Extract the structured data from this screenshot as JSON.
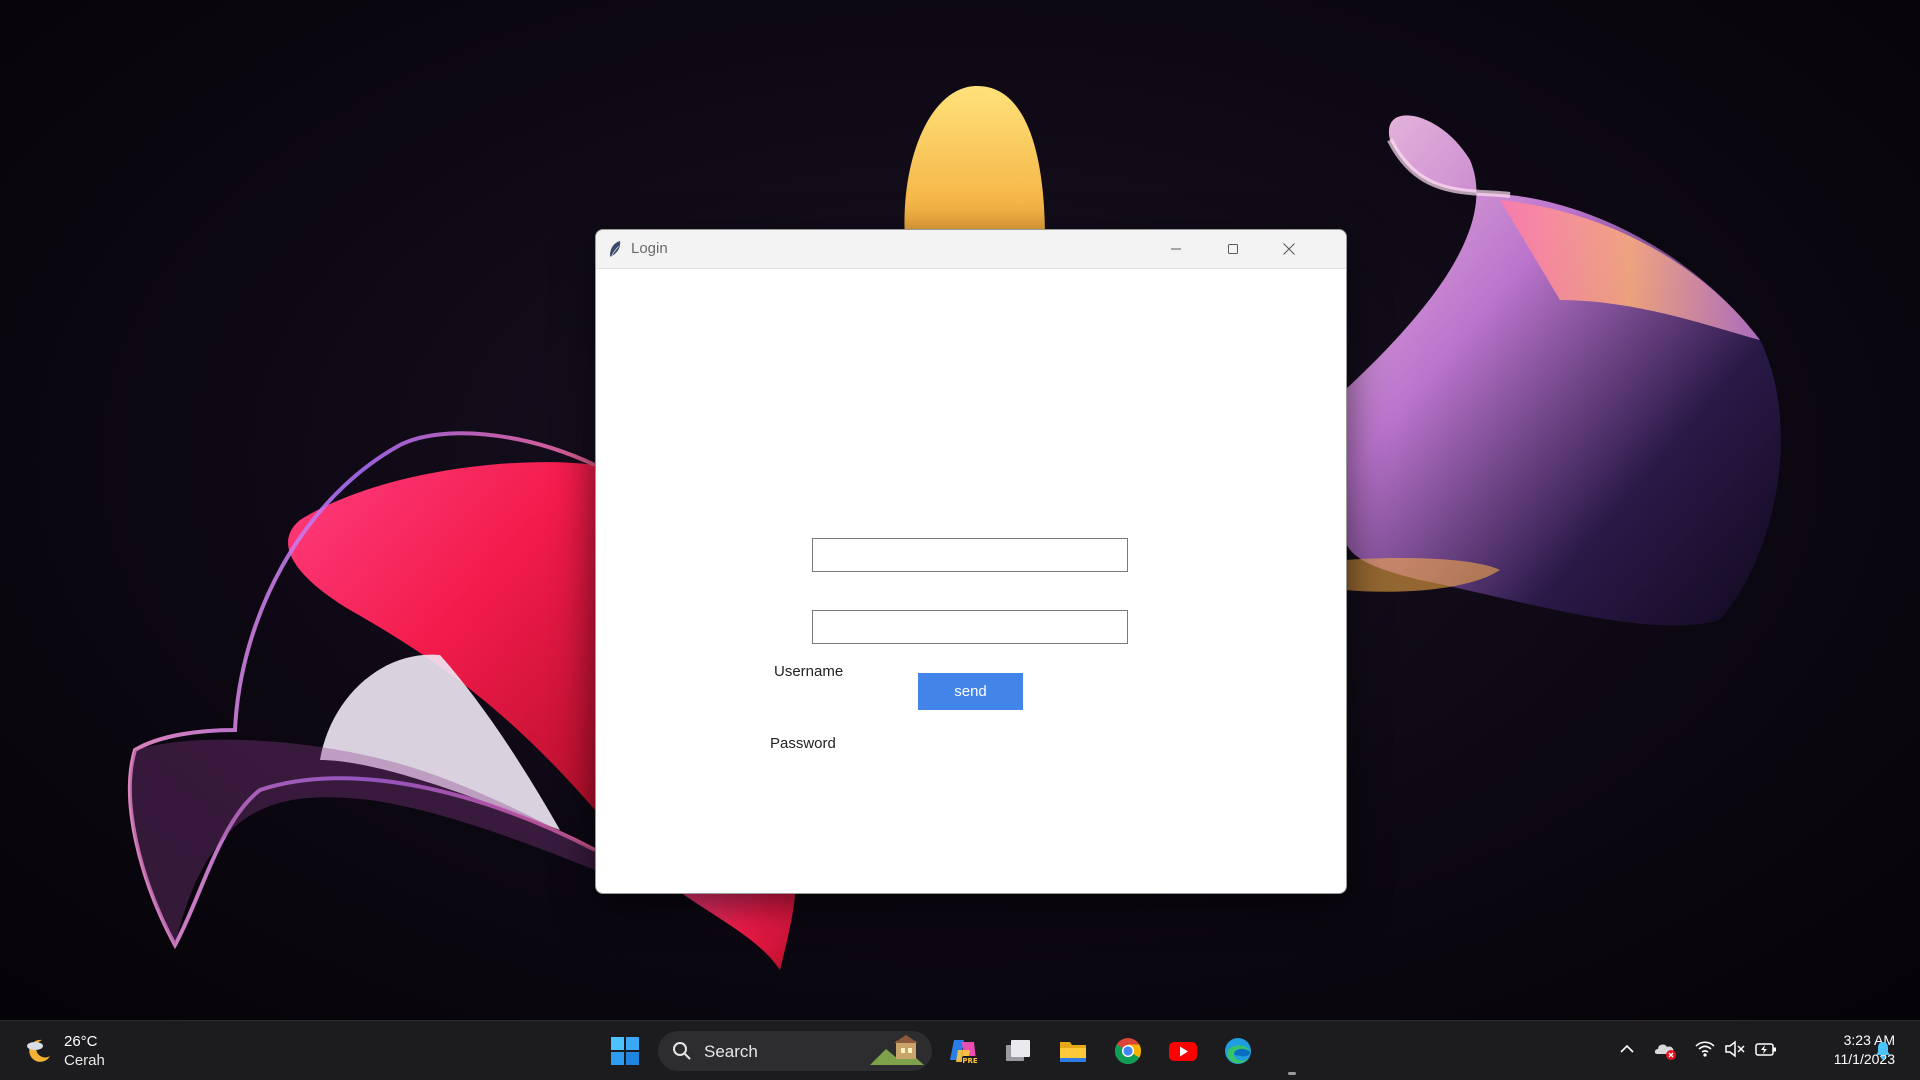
{
  "window": {
    "title": "Login",
    "username_label": "Username",
    "username_value": "",
    "password_label": "Password",
    "password_value": "",
    "send_label": "send"
  },
  "taskbar": {
    "weather": {
      "temperature": "26°C",
      "condition": "Cerah",
      "icon": "moon-weather-icon"
    },
    "search_label": "Search",
    "pinned_apps": [
      "copilot-icon",
      "task-view-icon",
      "file-explorer-icon",
      "chrome-icon",
      "youtube-icon",
      "edge-icon"
    ],
    "tray_icons": [
      "chevron-up-icon",
      "onedrive-icon",
      "wifi-icon",
      "volume-muted-icon",
      "battery-icon",
      "notification-bell-icon"
    ],
    "clock": {
      "time": "3:23 AM",
      "date": "11/1/2023"
    }
  },
  "colors": {
    "accent_button": "#4284e8",
    "taskbar_bg": "#1c1c1f",
    "titlebar_bg": "#f3f3f3"
  }
}
